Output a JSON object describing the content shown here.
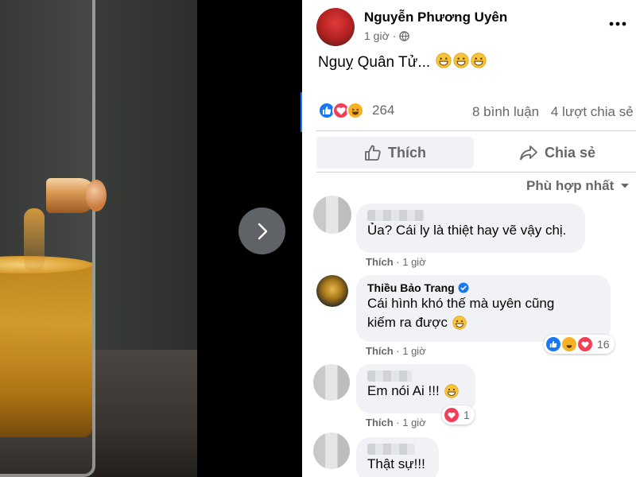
{
  "post": {
    "author": "Nguyễn Phương Uyên",
    "time": "1 giờ",
    "text": "Nguỵ Quân Tử...",
    "emoji_count": 3,
    "reaction_total": "264",
    "comment_count": "8 bình luận",
    "share_count": "4 lượt chia sẻ"
  },
  "actions": {
    "like_label": "Thích",
    "share_label": "Chia sẻ"
  },
  "sort_label": "Phù hợp nhất",
  "comments": [
    {
      "author": "",
      "text": "Ủa? Cái ly là thiệt hay vẽ vậy chị.",
      "like_label": "Thích",
      "time": "1 giờ"
    },
    {
      "author": "Thiều Bảo Trang",
      "verified": true,
      "text_line1": "Cái hình khó thế mà uyên cũng",
      "text_line2": "kiếm ra được",
      "like_label": "Thích",
      "time": "1 giờ",
      "reaction_count": "16"
    },
    {
      "author": "",
      "text": "Em nói Ai !!!",
      "like_label": "Thích",
      "time": "1 giờ",
      "reaction_count": "1"
    },
    {
      "author": "",
      "text": "Thật sự!!!"
    }
  ],
  "colors": {
    "facebook_blue": "#1877f2",
    "love_red": "#f33e58",
    "haha_yellow": "#f7b125",
    "secondary_text": "#65676b",
    "bubble_bg": "#f0f2f5"
  },
  "icons": [
    "chevron-right-icon",
    "globe-icon",
    "more-icon",
    "like-icon",
    "love-icon",
    "haha-icon",
    "thumbs-up-outline-icon",
    "share-arrow-icon",
    "caret-down-icon",
    "verified-badge-icon",
    "grin-emoji-icon"
  ]
}
